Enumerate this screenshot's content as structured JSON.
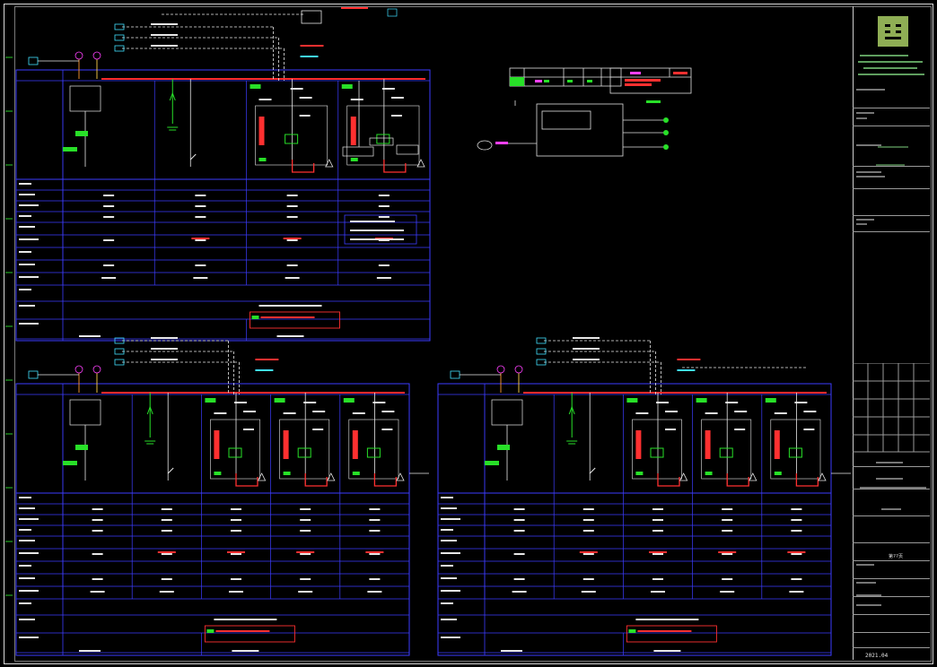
{
  "colors": {
    "background": "#000000",
    "panel_border": "#3d3dff",
    "busbar": "#ff2a2a",
    "wire_green": "#28e028",
    "text_white": "#e8e8e8",
    "highlight_red": "#ff3030",
    "accent_magenta": "#ff40ff",
    "accent_cyan": "#40e0ff",
    "logo_green": "#8fae55"
  },
  "title_block": {
    "date": "2021.04",
    "page": "第??页"
  }
}
